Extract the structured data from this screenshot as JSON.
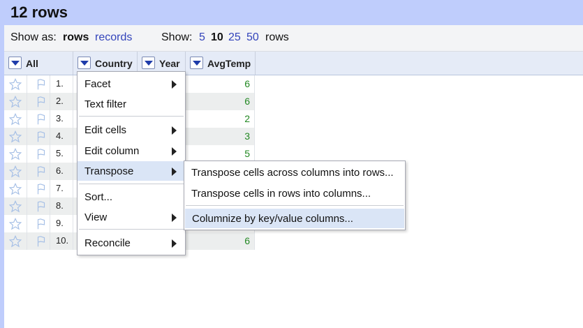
{
  "title": "12 rows",
  "view": {
    "show_as_label": "Show as:",
    "rows": "rows",
    "records": "records",
    "show_label": "Show:",
    "page_sizes": [
      "5",
      "10",
      "25",
      "50"
    ],
    "rows_suffix": "rows"
  },
  "columns": {
    "all": "All",
    "country": "Country",
    "year": "Year",
    "avgtemp": "AvgTemp"
  },
  "rows": [
    {
      "num": "1.",
      "avg": "6"
    },
    {
      "num": "2.",
      "avg": "6"
    },
    {
      "num": "3.",
      "avg": "2"
    },
    {
      "num": "4.",
      "avg": "3"
    },
    {
      "num": "5.",
      "avg": "5"
    },
    {
      "num": "6.",
      "avg": ""
    },
    {
      "num": "7.",
      "avg": ""
    },
    {
      "num": "8.",
      "avg": ""
    },
    {
      "num": "9.",
      "avg": ""
    },
    {
      "num": "10.",
      "avg": "6"
    }
  ],
  "menu": {
    "facet": "Facet",
    "text_filter": "Text filter",
    "edit_cells": "Edit cells",
    "edit_column": "Edit column",
    "transpose": "Transpose",
    "sort": "Sort...",
    "view": "View",
    "reconcile": "Reconcile"
  },
  "submenu": {
    "cols_into_rows": "Transpose cells across columns into rows...",
    "rows_into_cols": "Transpose cells in rows into columns...",
    "columnize": "Columnize by key/value columns..."
  },
  "colors": {
    "title_bg": "#bfcdfc",
    "link": "#3344bb",
    "number_green": "#228822",
    "menu_highlight": "#dae5f6"
  }
}
